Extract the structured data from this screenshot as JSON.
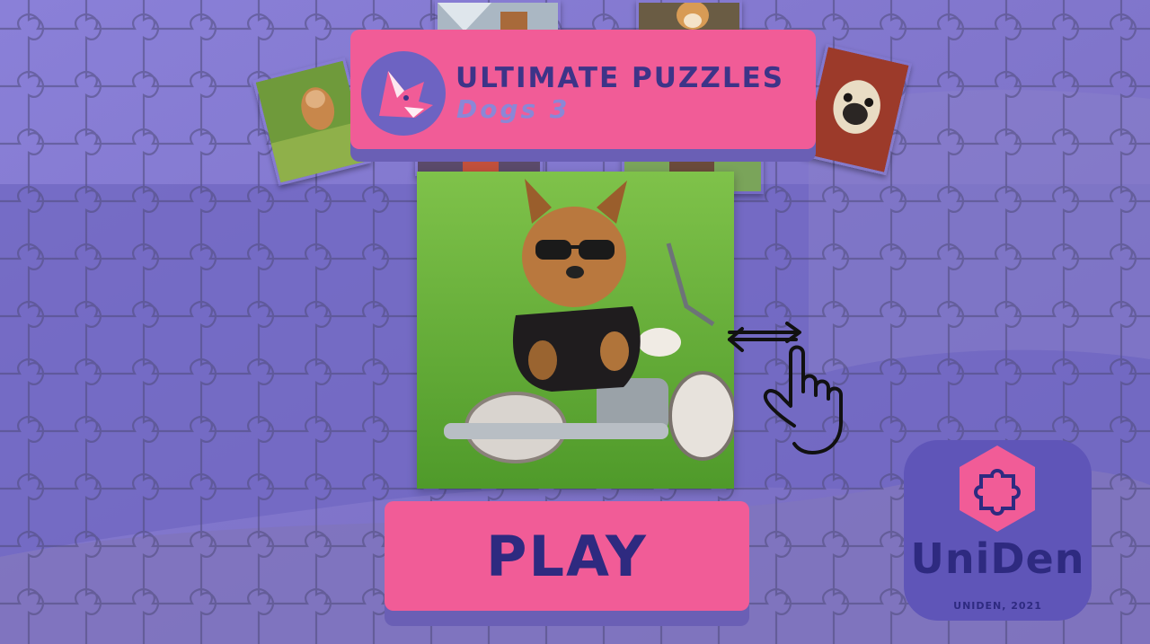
{
  "title": {
    "main": "ULTIMATE PUZZLES",
    "sub": "Dogs 3"
  },
  "play_button": {
    "label": "PLAY"
  },
  "brand": {
    "name": "UniDen",
    "copyright": "UNIDEN, 2021"
  },
  "icons": {
    "swipe_gesture": "hand-swipe-icon",
    "logo": "fox-head-icon",
    "brand_logo": "puzzle-piece-icon"
  },
  "colors": {
    "background": "#7a72c9",
    "accent_pink": "#f15c97",
    "navy_text": "#2e2a80",
    "banner_shadow": "#6a5fb5"
  }
}
